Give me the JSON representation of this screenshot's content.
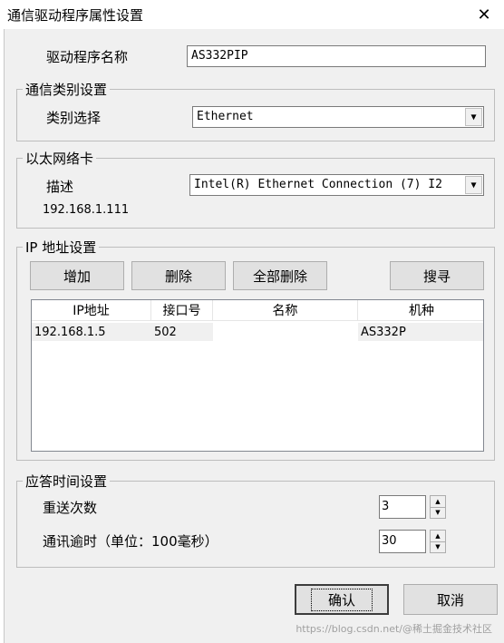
{
  "window": {
    "title": "通信驱动程序属性设置",
    "close_symbol": "✕"
  },
  "driver": {
    "label": "驱动程序名称",
    "value": "AS332PIP"
  },
  "comm_type": {
    "group_title": "通信类别设置",
    "label": "类别选择",
    "selected": "Ethernet"
  },
  "nic": {
    "group_title": "以太网络卡",
    "label": "描述",
    "selected": "Intel(R) Ethernet Connection (7) I2",
    "ip": "192.168.1.111"
  },
  "ip_settings": {
    "group_title": "IP 地址设置",
    "buttons": {
      "add": "增加",
      "delete": "删除",
      "delete_all": "全部删除",
      "search": "搜寻"
    },
    "columns": [
      "IP地址",
      "接口号",
      "名称",
      "机种"
    ],
    "rows": [
      {
        "ip": "192.168.1.5",
        "port": "502",
        "name": "",
        "model": "AS332P"
      }
    ]
  },
  "response": {
    "group_title": "应答时间设置",
    "retry_label": "重送次数",
    "retry_value": "3",
    "timeout_label": "通讯逾时（单位：100毫秒）",
    "timeout_value": "30"
  },
  "footer": {
    "ok": "确认",
    "cancel": "取消"
  },
  "watermark": "https://blog.csdn.net/@稀土掘金技术社区"
}
